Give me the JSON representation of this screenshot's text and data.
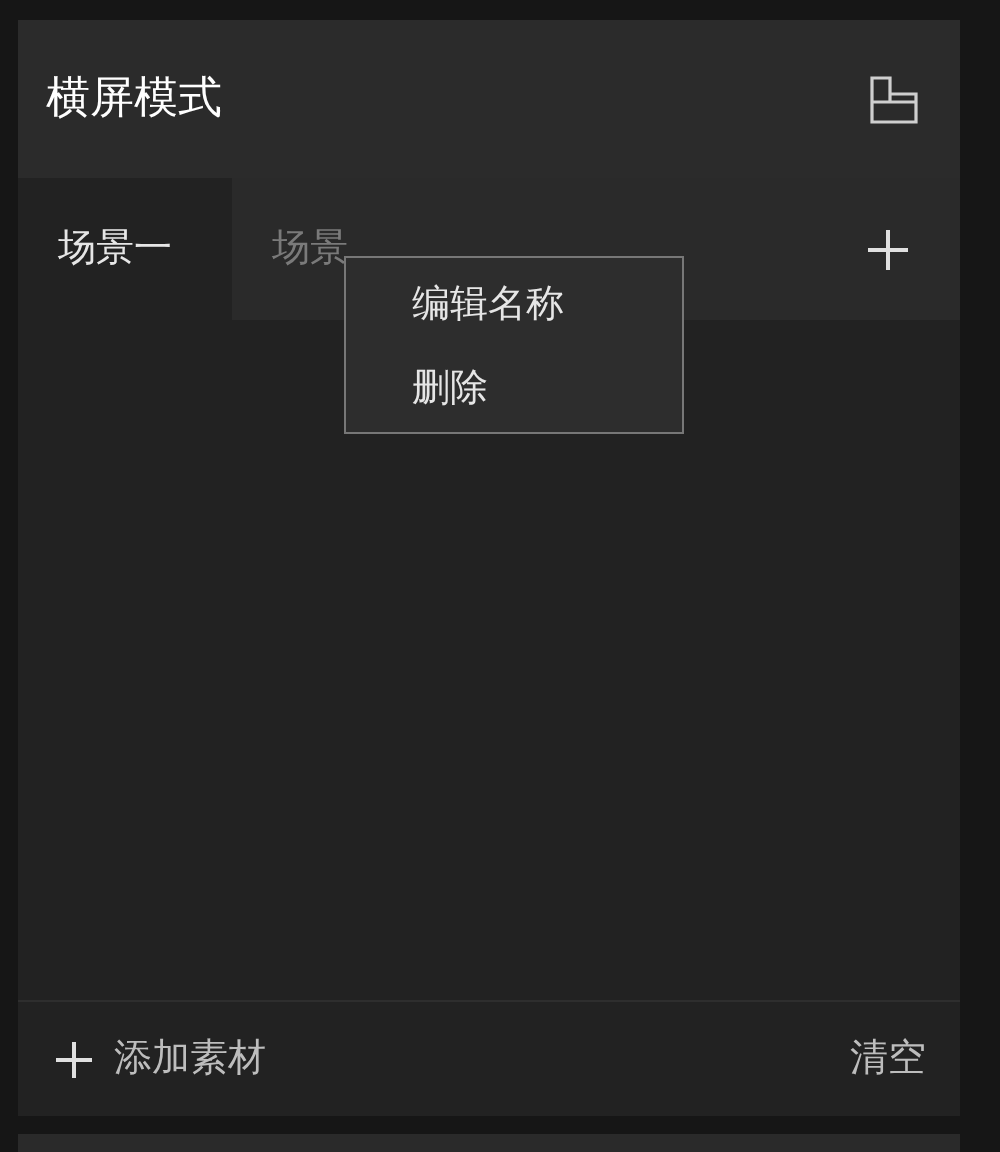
{
  "panel": {
    "title": "横屏模式"
  },
  "tabs": [
    {
      "label": "场景一",
      "selected": true
    },
    {
      "label": "场景",
      "selected": false
    }
  ],
  "context_menu": {
    "items": [
      "编辑名称",
      "删除"
    ]
  },
  "footer": {
    "add_label": "添加素材",
    "clear_label": "清空"
  }
}
